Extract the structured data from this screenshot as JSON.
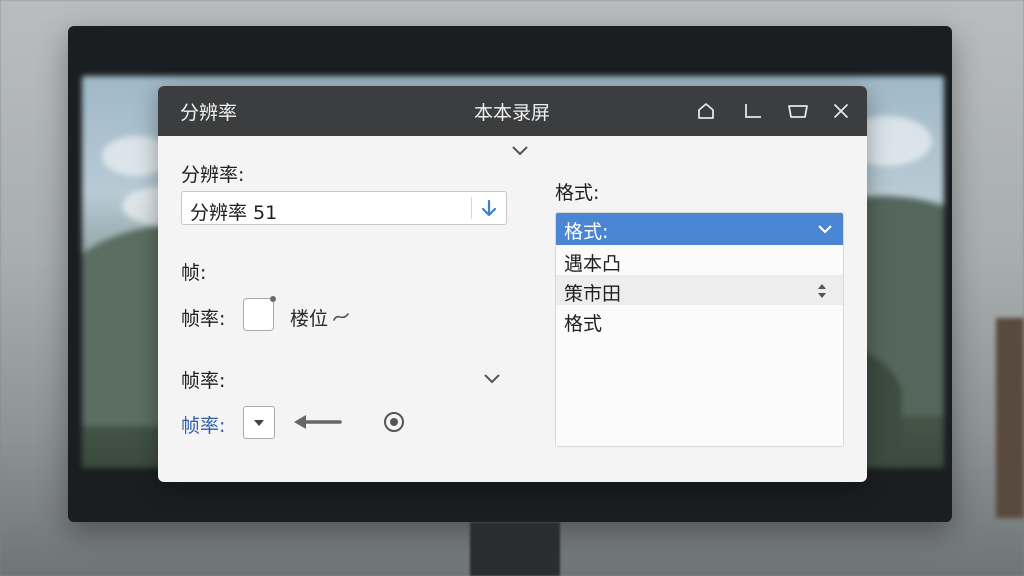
{
  "window": {
    "left_title": "分辨率",
    "center_title": "本本录屏"
  },
  "resolution": {
    "label": "分辨率:",
    "value": "分辨率 51"
  },
  "frame": {
    "heading": "帧:",
    "row1_label": "帧率:",
    "row1_text": "楼位",
    "row2_label": "帧率:",
    "row3_label": "帧率:"
  },
  "format": {
    "label": "格式:",
    "selected": "格式:",
    "options": [
      "遇本凸",
      "策市田",
      "格式"
    ]
  },
  "icons": {
    "home": "home-icon",
    "minimize": "minimize-icon",
    "restore": "restore-icon",
    "close": "close-icon",
    "download": "download-arrow-icon",
    "target": "target-icon"
  },
  "colors": {
    "titlebar": "#3c3d3e",
    "accent": "#4a86d4",
    "link_label": "#2f5fa8"
  }
}
